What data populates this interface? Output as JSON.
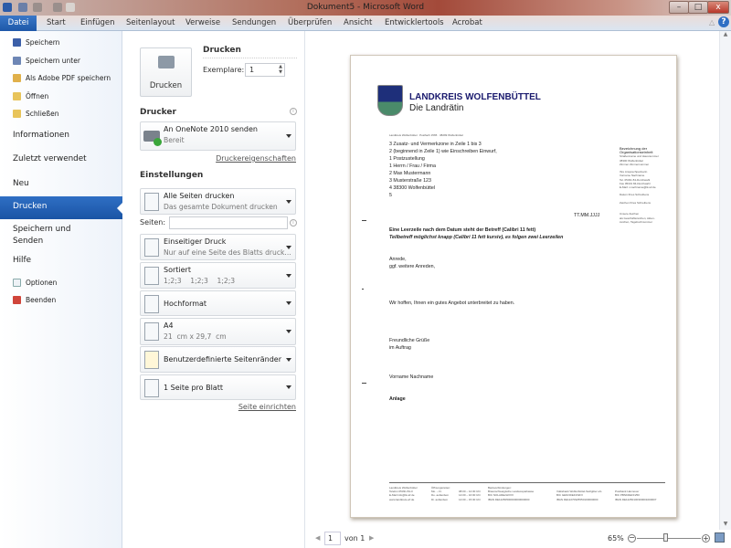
{
  "window": {
    "title": "Dokument5 - Microsoft Word"
  },
  "ribbon": {
    "tabs": [
      "Datei",
      "Start",
      "Einfügen",
      "Seitenlayout",
      "Verweise",
      "Sendungen",
      "Überprüfen",
      "Ansicht",
      "Entwicklertools",
      "Acrobat"
    ]
  },
  "nav": {
    "small_top": [
      "Speichern",
      "Speichern unter",
      "Als Adobe PDF speichern",
      "Öffnen",
      "Schließen"
    ],
    "big": [
      "Informationen",
      "Zuletzt verwendet",
      "Neu",
      "Drucken",
      "Speichern und Senden",
      "Hilfe"
    ],
    "small_bottom": [
      "Optionen",
      "Beenden"
    ]
  },
  "print": {
    "button": "Drucken",
    "heading": "Drucken",
    "copies_label": "Exemplare:",
    "copies_value": "1",
    "printer_heading": "Drucker",
    "printer_name": "An OneNote 2010 senden",
    "printer_status": "Bereit",
    "printer_props": "Druckereigenschaften",
    "settings_heading": "Einstellungen",
    "pages_label": "Seiten:",
    "pages_value": "",
    "settings": [
      {
        "l1": "Alle Seiten drucken",
        "l2": "Das gesamte Dokument drucken"
      },
      {
        "l1": "Einseitiger Druck",
        "l2": "Nur auf eine Seite des Blatts druck..."
      },
      {
        "l1": "Sortiert",
        "l2": "1;2;3    1;2;3    1;2;3"
      },
      {
        "l1": "Hochformat",
        "l2": ""
      },
      {
        "l1": "A4",
        "l2": "21  cm x 29,7  cm"
      },
      {
        "l1": "Benutzerdefinierte Seitenränder",
        "l2": ""
      },
      {
        "l1": "1 Seite pro Blatt",
        "l2": ""
      }
    ],
    "page_setup": "Seite einrichten"
  },
  "letter": {
    "org": "LANDKREIS WOLFENBÜTTEL",
    "sub": "Die Landrätin",
    "sender_line": "Landkreis Wolfenbüttel · Postfach 1565 · 38299 Wolfenbüttel",
    "address": [
      "3 Zusatz- und Vermerkzone in Zeile 1 bis 3",
      "2 (beginnend in Zeile 1) wie Einschreiben Einwurf,",
      "1 Postzustellung",
      "1 Herrn / Frau / Firma",
      "2 Max Mustermann",
      "3 Musterstraße 123",
      "4 38300 Wolfenbüttel",
      "5"
    ],
    "right_col": [
      "Bezeichnung der",
      "Organisationseinheit",
      "",
      "Straßenname und Hausnummer",
      "38300 Wolfenbüttel",
      "Zimmer Zimmernummer",
      "",
      "Ihre Ansprechpartnerin",
      "Vorname Nachname",
      "Tel. 05331 84-Durchwahl",
      "Fax 05331 84-Durchwahl",
      "E-Mail: v.nachname@lk-wf.de",
      "",
      "Datum Ihres Schreibens",
      "",
      "Zeichen Ihres Schreibens",
      "",
      "",
      "Unsere Zeichen",
      "als Geschäftszeichen, Akten-",
      "zeichen, Tagebuchnummer"
    ],
    "date": "TT.MM.JJJJ",
    "subject": "Eine Leerzeile nach dem Datum steht der Betreff (Calibri 11 fett)",
    "subject2": "Teilbetreff  möglichst knapp (Calibri 11 fett kursiv), es folgen zwei Leerzeilen",
    "salutation": "Anrede,",
    "salutation2": "ggf. weitere Anreden,",
    "body": "Wir hoffen, Ihnen ein gutes Angebot unterbreitet zu haben.",
    "closing": "Freundliche Grüße",
    "closing2": "im Auftrag",
    "signature": "Vorname  Nachname",
    "enclosure": "Anlage",
    "footer": [
      [
        "Landkreis Wolfenbüttel",
        "Telefon 05331 84-0",
        "E-Mail info@lk-wf.de",
        "www.landkreis-wf.de"
      ],
      [
        "Öffnungszeiten:",
        "Mo. – Fr.",
        "Do. außerdem",
        "Di. außerdem"
      ],
      [
        "",
        "08:00 – 12:30 Uhr",
        "14:00 – 16:00 Uhr",
        "14:00 – 15:30 Uhr"
      ],
      [
        "Bankverbindungen:",
        "Braunschweigische Landessparkasse",
        "BIC NOLADE2HXXX",
        "IBAN DE12250500000000000000"
      ],
      [
        "",
        "Volksbank Wolfenbüttel-Salzgitter eG",
        "BIC GENODEF1WFV",
        "IBAN DE12270925550100000000"
      ],
      [
        "",
        "Postbank Hannover",
        "BIC PBNKDEFF250",
        "IBAN DE12250100300001000007"
      ]
    ]
  },
  "status": {
    "page": "1",
    "of": "von 1",
    "zoom": "65%",
    "zoom_fraction": 0.45
  }
}
